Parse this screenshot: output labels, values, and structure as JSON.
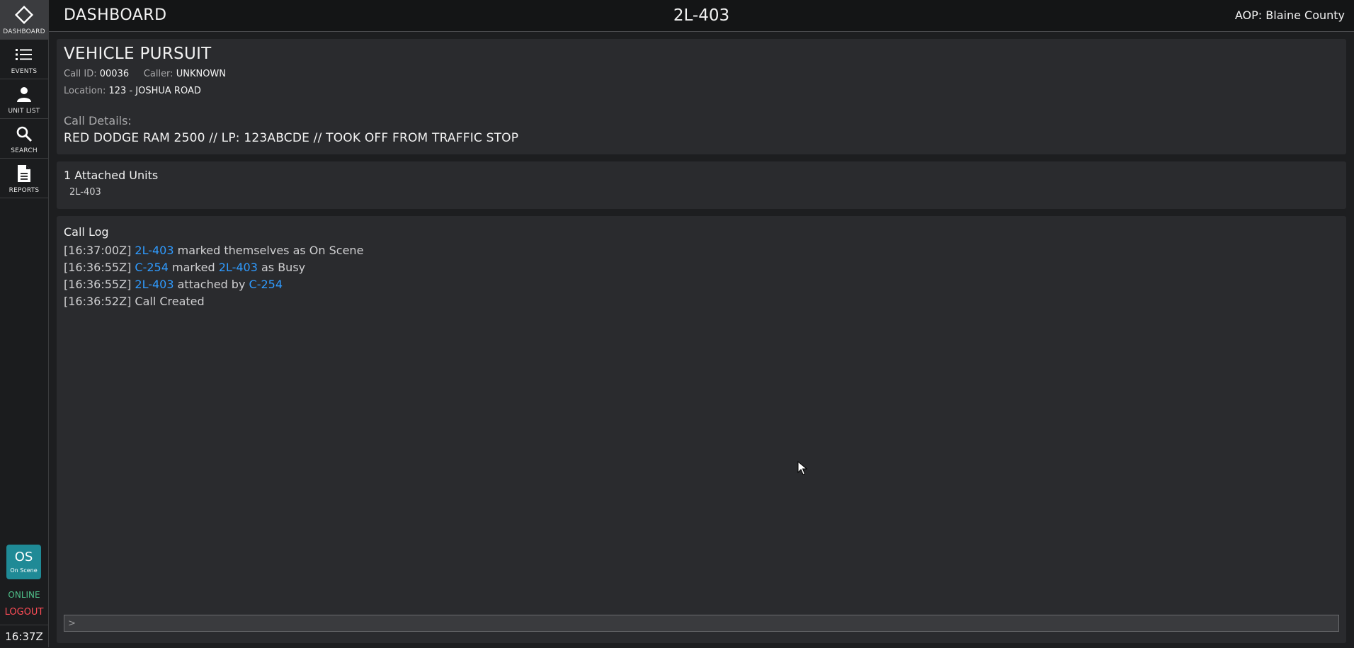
{
  "sidebar": {
    "items": [
      {
        "label": "DASHBOARD",
        "icon": "diamond-icon"
      },
      {
        "label": "EVENTS",
        "icon": "list-icon"
      },
      {
        "label": "UNIT LIST",
        "icon": "person-icon"
      },
      {
        "label": "SEARCH",
        "icon": "search-icon"
      },
      {
        "label": "REPORTS",
        "icon": "document-icon"
      }
    ],
    "status": {
      "code": "OS",
      "label": "On Scene",
      "color": "#1f8a96"
    },
    "online": "ONLINE",
    "logout": "LOGOUT",
    "clock": "16:37Z"
  },
  "header": {
    "title": "DASHBOARD",
    "unit": "2L-403",
    "aop": "AOP: Blaine County"
  },
  "call": {
    "title": "VEHICLE PURSUIT",
    "call_id_label": "Call ID:",
    "call_id": "00036",
    "caller_label": "Caller:",
    "caller": "UNKNOWN",
    "location_label": "Location:",
    "location": "123 - JOSHUA ROAD",
    "details_label": "Call Details:",
    "details": "RED DODGE RAM 2500 // LP: 123ABCDE // TOOK OFF FROM TRAFFIC STOP"
  },
  "units": {
    "title": "1 Attached Units",
    "list": [
      "2L-403"
    ]
  },
  "log": {
    "title": "Call Log",
    "entries": [
      {
        "time": "[16:37:00Z]",
        "a": "2L-403",
        "t1": "marked themselves as On Scene"
      },
      {
        "time": "[16:36:55Z]",
        "a": "C-254",
        "t1": "marked",
        "b": "2L-403",
        "t2": "as Busy"
      },
      {
        "time": "[16:36:55Z]",
        "a": "2L-403",
        "t1": "attached by",
        "b": "C-254"
      },
      {
        "time": "[16:36:52Z]",
        "t1": "Call Created"
      }
    ],
    "prompt": ">",
    "input_value": ""
  },
  "colors": {
    "link": "#2f9bff",
    "online": "#4fc08a",
    "logout": "#ff4d57"
  }
}
